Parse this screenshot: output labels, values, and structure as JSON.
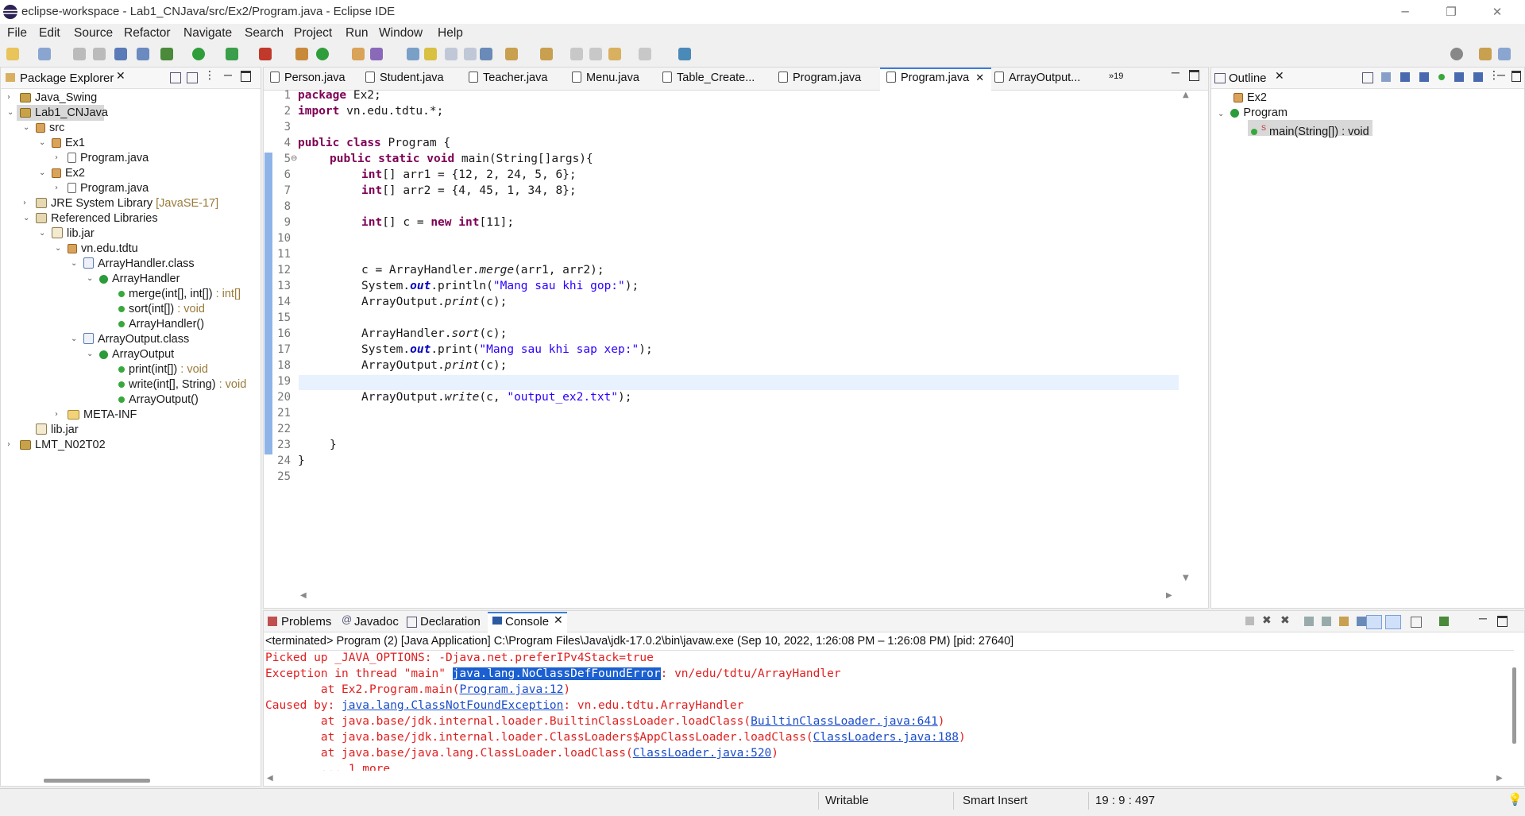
{
  "window": {
    "title": "eclipse-workspace - Lab1_CNJava/src/Ex2/Program.java - Eclipse IDE",
    "minimize": "─",
    "restore": "❐",
    "close": "✕"
  },
  "menu": [
    "File",
    "Edit",
    "Source",
    "Refactor",
    "Navigate",
    "Search",
    "Project",
    "Run",
    "Window",
    "Help"
  ],
  "package_explorer": {
    "tab": "Package Explorer",
    "items": [
      {
        "label": "Java_Swing"
      },
      {
        "label": "Lab1_CNJava"
      },
      {
        "label": "src"
      },
      {
        "label": "Ex1"
      },
      {
        "label": "Program.java"
      },
      {
        "label": "Ex2"
      },
      {
        "label": "Program.java"
      },
      {
        "label": "JRE System Library",
        "suffix": "[JavaSE-17]"
      },
      {
        "label": "Referenced Libraries"
      },
      {
        "label": "lib.jar"
      },
      {
        "label": "vn.edu.tdtu"
      },
      {
        "label": "ArrayHandler.class"
      },
      {
        "label": "ArrayHandler"
      },
      {
        "label": "merge(int[], int[])",
        "suffix": ": int[]"
      },
      {
        "label": "sort(int[])",
        "suffix": ": void"
      },
      {
        "label": "ArrayHandler()"
      },
      {
        "label": "ArrayOutput.class"
      },
      {
        "label": "ArrayOutput"
      },
      {
        "label": "print(int[])",
        "suffix": ": void"
      },
      {
        "label": "write(int[], String)",
        "suffix": ": void"
      },
      {
        "label": "ArrayOutput()"
      },
      {
        "label": "META-INF"
      },
      {
        "label": "lib.jar"
      },
      {
        "label": "LMT_N02T02"
      }
    ]
  },
  "editor": {
    "tabs": [
      "Person.java",
      "Student.java",
      "Teacher.java",
      "Menu.java",
      "Table_Create...",
      "Program.java",
      "Program.java",
      "ArrayOutput..."
    ],
    "overflow": "»19",
    "active_tab_index": 6,
    "line_numbers": [
      "1",
      "2",
      "3",
      "4",
      "5",
      "6",
      "7",
      "8",
      "9",
      "10",
      "11",
      "12",
      "13",
      "14",
      "15",
      "16",
      "17",
      "18",
      "19",
      "20",
      "21",
      "22",
      "23",
      "24",
      "25"
    ],
    "fold_marker": "⊖",
    "code": {
      "l1_kw": "package",
      "l1_rest": " Ex2;",
      "l2_kw": "import",
      "l2_rest": " vn.edu.tdtu.*;",
      "l4_kw1": "public",
      "l4_kw2": "class",
      "l4_rest": " Program {",
      "l5_kw1": "public",
      "l5_kw2": "static",
      "l5_kw3": "void",
      "l5_rest": " main(String[]args){",
      "l6_kw": "int",
      "l6_rest": "[] arr1 = {12, 2, 24, 5, 6};",
      "l7_kw": "int",
      "l7_rest": "[] arr2 = {4, 45, 1, 34, 8};",
      "l9_kw": "int",
      "l9_mid": "[] c = ",
      "l9_kw2": "new",
      "l9_kw3": "int",
      "l9_rest": "[11];",
      "l12_a": "c = ArrayHandler.",
      "l12_it": "merge",
      "l12_b": "(arr1, arr2);",
      "l13_a": "System.",
      "l13_fld": "out",
      "l13_b": ".println(",
      "l13_str": "\"Mang sau khi gop:\"",
      "l13_c": ");",
      "l14_a": "ArrayOutput.",
      "l14_it": "print",
      "l14_b": "(c);",
      "l16_a": "ArrayHandler.",
      "l16_it": "sort",
      "l16_b": "(c);",
      "l17_a": "System.",
      "l17_fld": "out",
      "l17_b": ".print(",
      "l17_str": "\"Mang sau khi sap xep:\"",
      "l17_c": ");",
      "l18_a": "ArrayOutput.",
      "l18_it": "print",
      "l18_b": "(c);",
      "l20_a": "ArrayOutput.",
      "l20_it": "write",
      "l20_b": "(c, ",
      "l20_str": "\"output_ex2.txt\"",
      "l20_c": ");",
      "l23": "}",
      "l24": "}"
    }
  },
  "outline": {
    "tab": "Outline",
    "items": [
      {
        "label": "Ex2"
      },
      {
        "label": "Program"
      },
      {
        "label": "main(String[]) : void"
      }
    ],
    "static_marker": "S"
  },
  "bottom": {
    "tabs": [
      "Problems",
      "Javadoc",
      "Declaration",
      "Console"
    ],
    "active_tab": "Console",
    "launch_info": "<terminated> Program (2) [Java Application] C:\\Program Files\\Java\\jdk-17.0.2\\bin\\javaw.exe  (Sep 10, 2022, 1:26:08 PM – 1:26:08 PM) [pid: 27640]",
    "console": {
      "c1": "Picked up _JAVA_OPTIONS: -Djava.net.preferIPv4Stack=true",
      "c2a": "Exception in thread \"main\" ",
      "c2sel": "java.lang.NoClassDefFoundError",
      "c2b": ": vn/edu/tdtu/ArrayHandler",
      "c3a": "        at Ex2.Program.main(",
      "c3lnk": "Program.java:12",
      "c3b": ")",
      "c4a": "Caused by: ",
      "c4lnk": "java.lang.ClassNotFoundException",
      "c4b": ": vn.edu.tdtu.ArrayHandler",
      "c5a": "        at java.base/jdk.internal.loader.BuiltinClassLoader.loadClass(",
      "c5lnk": "BuiltinClassLoader.java:641",
      "c5b": ")",
      "c6a": "        at java.base/jdk.internal.loader.ClassLoaders$AppClassLoader.loadClass(",
      "c6lnk": "ClassLoaders.java:188",
      "c6b": ")",
      "c7a": "        at java.base/java.lang.ClassLoader.loadClass(",
      "c7lnk": "ClassLoader.java:520",
      "c7b": ")",
      "c8": "        ... 1 more"
    }
  },
  "status": {
    "mode": "Writable",
    "insert": "Smart Insert",
    "position": "19 : 9 : 497"
  }
}
